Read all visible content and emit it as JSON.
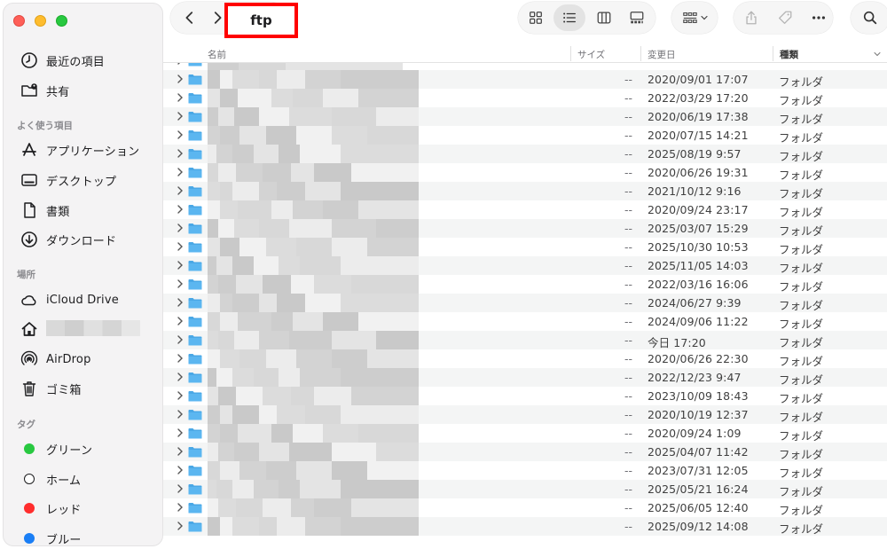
{
  "window": {
    "title": "ftp"
  },
  "sidebar": {
    "favorites_top": [
      {
        "label": "最近の項目",
        "icon": "clock-icon"
      },
      {
        "label": "共有",
        "icon": "shared-folder-icon"
      }
    ],
    "section_favorites": "よく使う項目",
    "favorites": [
      {
        "label": "アプリケーション",
        "icon": "applications-icon"
      },
      {
        "label": "デスクトップ",
        "icon": "desktop-icon"
      },
      {
        "label": "書類",
        "icon": "document-icon"
      },
      {
        "label": "ダウンロード",
        "icon": "download-icon"
      }
    ],
    "section_locations": "場所",
    "locations": [
      {
        "label": "iCloud Drive",
        "icon": "cloud-icon"
      },
      {
        "label": "",
        "icon": "home-icon"
      },
      {
        "label": "AirDrop",
        "icon": "airdrop-icon"
      },
      {
        "label": "ゴミ箱",
        "icon": "trash-icon"
      }
    ],
    "section_tags": "タグ",
    "tags": [
      {
        "label": "グリーン",
        "color": "#28c840"
      },
      {
        "label": "ホーム",
        "color": "#ffffff"
      },
      {
        "label": "レッド",
        "color": "#ff2d2d"
      },
      {
        "label": "ブルー",
        "color": "#1a7ef5"
      }
    ]
  },
  "columns": {
    "name": "名前",
    "size": "サイズ",
    "modified": "変更日",
    "kind": "種類"
  },
  "rows": [
    {
      "size": "--",
      "date": "2020/09/01 17:07",
      "kind": "フォルダ"
    },
    {
      "size": "--",
      "date": "2022/03/29 17:20",
      "kind": "フォルダ"
    },
    {
      "size": "--",
      "date": "2020/06/19 17:38",
      "kind": "フォルダ"
    },
    {
      "size": "--",
      "date": "2020/07/15 14:21",
      "kind": "フォルダ"
    },
    {
      "size": "--",
      "date": "2025/08/19 9:57",
      "kind": "フォルダ"
    },
    {
      "size": "--",
      "date": "2020/06/26 19:31",
      "kind": "フォルダ"
    },
    {
      "size": "--",
      "date": "2021/10/12 9:16",
      "kind": "フォルダ"
    },
    {
      "size": "--",
      "date": "2020/09/24 23:17",
      "kind": "フォルダ"
    },
    {
      "size": "--",
      "date": "2025/03/07 15:29",
      "kind": "フォルダ"
    },
    {
      "size": "--",
      "date": "2025/10/30 10:53",
      "kind": "フォルダ"
    },
    {
      "size": "--",
      "date": "2025/11/05 14:03",
      "kind": "フォルダ"
    },
    {
      "size": "--",
      "date": "2022/03/16 16:06",
      "kind": "フォルダ"
    },
    {
      "size": "--",
      "date": "2024/06/27 9:39",
      "kind": "フォルダ"
    },
    {
      "size": "--",
      "date": "2024/09/06 11:22",
      "kind": "フォルダ"
    },
    {
      "size": "--",
      "date": "今日 17:20",
      "kind": "フォルダ"
    },
    {
      "size": "--",
      "date": "2020/06/26 22:30",
      "kind": "フォルダ"
    },
    {
      "size": "--",
      "date": "2022/12/23 9:47",
      "kind": "フォルダ"
    },
    {
      "size": "--",
      "date": "2023/10/09 18:43",
      "kind": "フォルダ"
    },
    {
      "size": "--",
      "date": "2020/10/19 12:37",
      "kind": "フォルダ"
    },
    {
      "size": "--",
      "date": "2020/09/24 1:09",
      "kind": "フォルダ"
    },
    {
      "size": "--",
      "date": "2025/04/07 11:42",
      "kind": "フォルダ"
    },
    {
      "size": "--",
      "date": "2023/07/31 12:05",
      "kind": "フォルダ"
    },
    {
      "size": "--",
      "date": "2025/05/21 16:24",
      "kind": "フォルダ"
    },
    {
      "size": "--",
      "date": "2025/06/05 12:40",
      "kind": "フォルダ"
    },
    {
      "size": "--",
      "date": "2025/09/12 14:08",
      "kind": "フォルダ"
    }
  ],
  "colors": {
    "folder": "#4aa8e6",
    "highlight_box": "#ff0000"
  }
}
